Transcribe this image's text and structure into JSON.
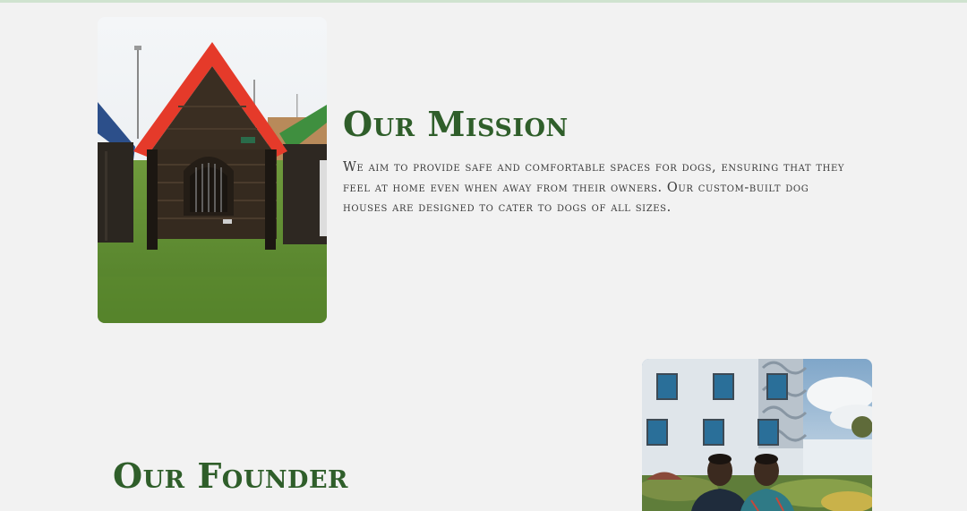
{
  "mission": {
    "title": "Our Mission",
    "body": "We aim to provide safe and comfortable spaces for dogs, ensuring that they feel at home even when away from their owners. Our custom-built dog houses are designed to cater to dogs of all sizes."
  },
  "founder": {
    "title": "Our Founder"
  },
  "colors": {
    "heading": "#2f5e2a",
    "body_text": "#3a3a3a",
    "background": "#f2f2f2",
    "top_border": "#cfe3cf"
  }
}
